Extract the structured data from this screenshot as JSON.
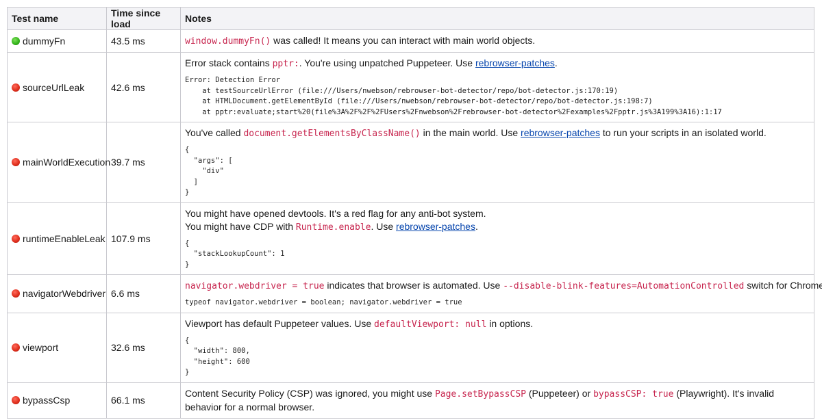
{
  "headers": [
    "Test name",
    "Time since load",
    "Notes"
  ],
  "rows": [
    {
      "status": "pass",
      "name": "dummyFn",
      "time": "43.5 ms",
      "note_parts": [
        "window.dummyFn()",
        " was called! It means you can interact with main world objects."
      ]
    },
    {
      "status": "fail",
      "name": "sourceUrlLeak",
      "time": "42.6 ms",
      "note_parts": [
        "Error stack contains ",
        "pptr:",
        ". You're using unpatched Puppeteer. Use ",
        "rebrowser-patches",
        "."
      ],
      "pre": "Error: Detection Error\n    at testSourceUrlError (file:///Users/nwebson/rebrowser-bot-detector/repo/bot-detector.js:170:19)\n    at HTMLDocument.getElementById (file:///Users/nwebson/rebrowser-bot-detector/repo/bot-detector.js:198:7)\n    at pptr:evaluate;start%20(file%3A%2F%2F%2FUsers%2Fnwebson%2Frebrowser-bot-detector%2Fexamples%2Fpptr.js%3A199%3A16):1:17"
    },
    {
      "status": "fail",
      "name": "mainWorldExecution",
      "time": "39.7 ms",
      "note_parts": [
        "You've called ",
        "document.getElementsByClassName()",
        " in the main world. Use ",
        "rebrowser-patches",
        " to run your scripts in an isolated world."
      ],
      "pre": "{\n  \"args\": [\n    \"div\"\n  ]\n}"
    },
    {
      "status": "fail",
      "name": "runtimeEnableLeak",
      "time": "107.9 ms",
      "note_line1": "You might have opened devtools. It's a red flag for any anti-bot system.",
      "note_parts": [
        "You might have CDP with ",
        "Runtime.enable",
        ". Use ",
        "rebrowser-patches",
        "."
      ],
      "pre": "{\n  \"stackLookupCount\": 1\n}"
    },
    {
      "status": "fail",
      "name": "navigatorWebdriver",
      "time": "6.6 ms",
      "note_parts": [
        "navigator.webdriver = true",
        " indicates that browser is automated. Use ",
        "--disable-blink-features=AutomationControlled",
        " switch for Chrome."
      ],
      "pre": "typeof navigator.webdriver = boolean; navigator.webdriver = true"
    },
    {
      "status": "fail",
      "name": "viewport",
      "time": "32.6 ms",
      "note_parts": [
        "Viewport has default Puppeteer values. Use ",
        "defaultViewport: null",
        " in options."
      ],
      "pre": "{\n  \"width\": 800,\n  \"height\": 600\n}"
    },
    {
      "status": "fail",
      "name": "bypassCsp",
      "time": "66.1 ms",
      "note_parts": [
        "Content Security Policy (CSP) was ignored, you might use ",
        "Page.setBypassCSP",
        " (Puppeteer) or ",
        "bypassCSP: true",
        " (Playwright). It's invalid behavior for a normal browser."
      ]
    }
  ],
  "colors": {
    "code": "#c7254e",
    "link": "#0645ad",
    "fail": "#e0301e",
    "pass": "#35b51c",
    "header_bg": "#f3f3f6",
    "border": "#c9c9cf"
  }
}
